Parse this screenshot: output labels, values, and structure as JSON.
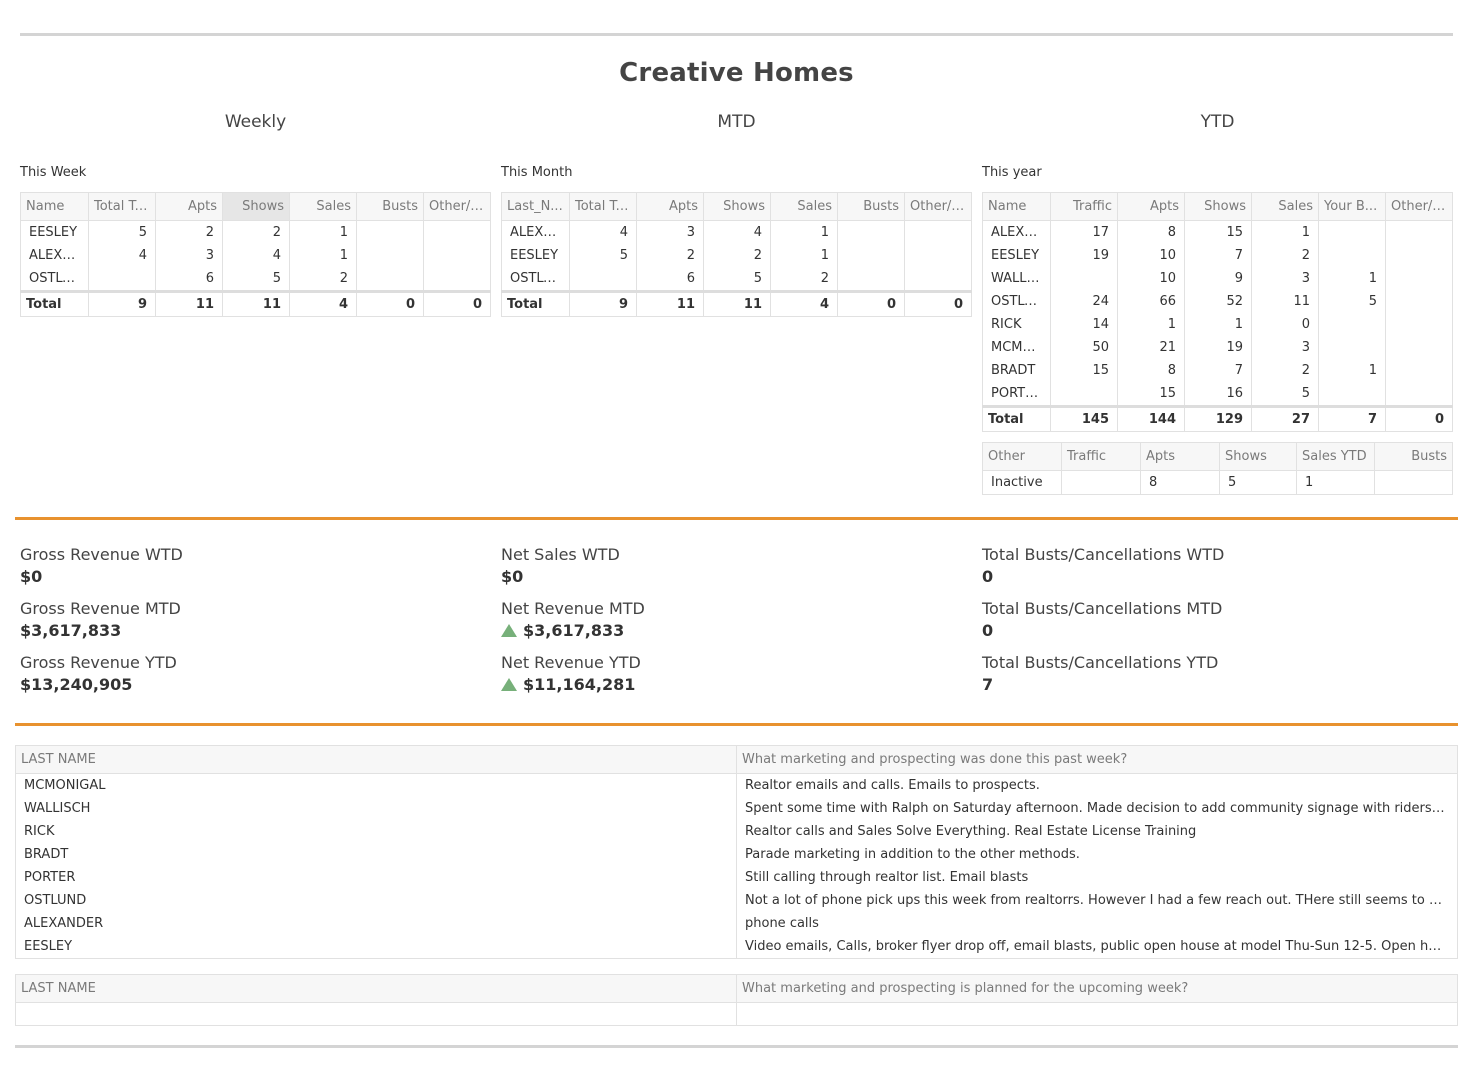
{
  "title": "Creative Homes",
  "sections": {
    "weekly": "Weekly",
    "mtd": "MTD",
    "ytd": "YTD"
  },
  "weekly": {
    "caption": "This Week",
    "columns": [
      "Name",
      "Total Tr...",
      "Apts",
      "Shows",
      "Sales",
      "Busts",
      "Other/F..."
    ],
    "rows": [
      [
        "EESLEY",
        "5",
        "2",
        "2",
        "1",
        "",
        ""
      ],
      [
        "ALEXA...",
        "4",
        "3",
        "4",
        "1",
        "",
        ""
      ],
      [
        "OSTLU...",
        "",
        "6",
        "5",
        "2",
        "",
        ""
      ]
    ],
    "total": [
      "Total",
      "9",
      "11",
      "11",
      "4",
      "0",
      "0"
    ]
  },
  "mtd": {
    "caption": "This Month",
    "columns": [
      "Last_N...",
      "Total Tr...",
      "Apts",
      "Shows",
      "Sales",
      "Busts",
      "Other/F..."
    ],
    "rows": [
      [
        "ALEXA...",
        "4",
        "3",
        "4",
        "1",
        "",
        ""
      ],
      [
        "EESLEY",
        "5",
        "2",
        "2",
        "1",
        "",
        ""
      ],
      [
        "OSTLU...",
        "",
        "6",
        "5",
        "2",
        "",
        ""
      ]
    ],
    "total": [
      "Total",
      "9",
      "11",
      "11",
      "4",
      "0",
      "0"
    ]
  },
  "ytd": {
    "caption": "This year",
    "columns": [
      "Name",
      "Traffic",
      "Apts",
      "Shows",
      "Sales",
      "Your B...",
      "Other/F..."
    ],
    "rows": [
      [
        "ALEXA...",
        "17",
        "8",
        "15",
        "1",
        "",
        ""
      ],
      [
        "EESLEY",
        "19",
        "10",
        "7",
        "2",
        "",
        ""
      ],
      [
        "WALLI...",
        "",
        "10",
        "9",
        "3",
        "1",
        ""
      ],
      [
        "OSTLU...",
        "24",
        "66",
        "52",
        "11",
        "5",
        ""
      ],
      [
        "RICK",
        "14",
        "1",
        "1",
        "0",
        "",
        ""
      ],
      [
        "MCMO...",
        "50",
        "21",
        "19",
        "3",
        "",
        ""
      ],
      [
        "BRADT",
        "15",
        "8",
        "7",
        "2",
        "1",
        ""
      ],
      [
        "PORTER",
        "",
        "15",
        "16",
        "5",
        "",
        ""
      ]
    ],
    "total": [
      "Total",
      "145",
      "144",
      "129",
      "27",
      "7",
      "0"
    ]
  },
  "other": {
    "columns": [
      "Other",
      "Traffic",
      "Apts",
      "Shows",
      "Sales YTD",
      "Busts"
    ],
    "row": [
      "Inactive",
      "",
      "8",
      "5",
      "1",
      ""
    ]
  },
  "kpis": {
    "gross_wtd_label": "Gross Revenue WTD",
    "gross_wtd": "$0",
    "gross_mtd_label": "Gross Revenue MTD",
    "gross_mtd": "$3,617,833",
    "gross_ytd_label": "Gross Revenue YTD",
    "gross_ytd": "$13,240,905",
    "net_wtd_label": "Net Sales WTD",
    "net_wtd": "$0",
    "net_mtd_label": "Net Revenue MTD",
    "net_mtd": "$3,617,833",
    "net_ytd_label": "Net Revenue YTD",
    "net_ytd": "$11,164,281",
    "busts_wtd_label": "Total Busts/Cancellations WTD",
    "busts_wtd": "0",
    "busts_mtd_label": "Total Busts/Cancellations MTD",
    "busts_mtd": "0",
    "busts_ytd_label": "Total Busts/Cancellations YTD",
    "busts_ytd": "7",
    "up_color": "#77b07a"
  },
  "past_week": {
    "col_name": "LAST NAME",
    "col_text": "What marketing and prospecting was done this past week?",
    "rows": [
      [
        "MCMONIGAL",
        "Realtor emails and calls. Emails to prospects."
      ],
      [
        "WALLISCH",
        "Spent some time with Ralph on Saturday afternoon. Made decision to add community signage with riders: One Level ..."
      ],
      [
        "RICK",
        "Realtor calls and Sales Solve Everything. Real Estate License Training"
      ],
      [
        "BRADT",
        "Parade marketing in addition to the other methods."
      ],
      [
        "PORTER",
        "Still calling through realtor list. Email blasts"
      ],
      [
        "OSTLUND",
        "Not a lot of phone pick ups this week from realtorrs. However I had a few reach out. THere still seems to be a bunch o..."
      ],
      [
        "ALEXANDER",
        "phone calls"
      ],
      [
        "EESLEY",
        "Video emails, Calls, broker flyer drop off, email blasts, public open house at model Thu-Sun 12-5. Open house, Video ..."
      ]
    ]
  },
  "upcoming_week": {
    "col_name": "LAST NAME",
    "col_text": "What marketing and prospecting is planned for the upcoming week?"
  },
  "colors": {
    "accent_rule": "#e8922e",
    "header_bg": "#f7f7f7"
  }
}
